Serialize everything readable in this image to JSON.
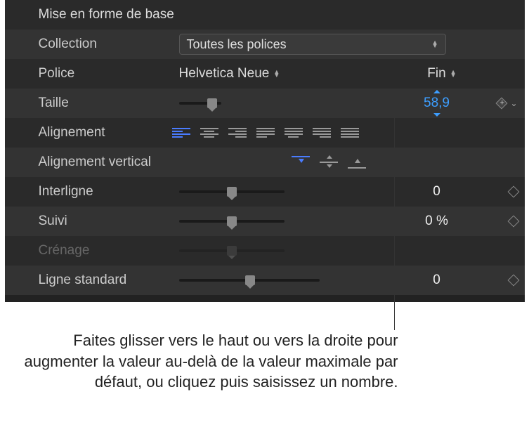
{
  "panel": {
    "title": "Mise en forme de base",
    "rows": {
      "collection": {
        "label": "Collection",
        "value": "Toutes les polices"
      },
      "police": {
        "label": "Police",
        "font": "Helvetica Neue",
        "style": "Fin"
      },
      "taille": {
        "label": "Taille",
        "value": "58,9"
      },
      "alignement": {
        "label": "Alignement"
      },
      "valign": {
        "label": "Alignement vertical"
      },
      "interligne": {
        "label": "Interligne",
        "value": "0"
      },
      "suivi": {
        "label": "Suivi",
        "value": "0 %"
      },
      "crenage": {
        "label": "Crénage"
      },
      "baseline": {
        "label": "Ligne standard",
        "value": "0"
      }
    }
  },
  "callout": {
    "text": "Faites glisser vers le haut ou vers la droite pour augmenter la valeur au-delà de la valeur maximale par défaut, ou cliquez puis saisissez un nombre."
  }
}
